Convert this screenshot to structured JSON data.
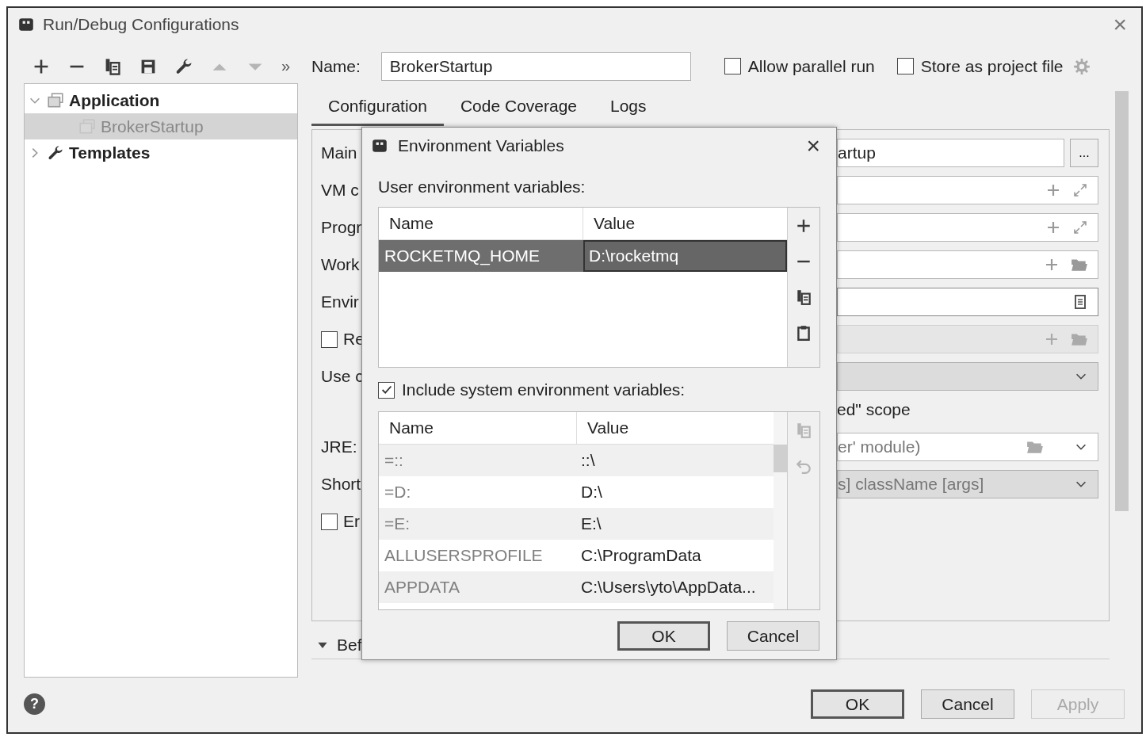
{
  "window": {
    "title": "Run/Debug Configurations",
    "close": "×"
  },
  "toolbar": [
    {
      "kind": "add",
      "disabled": false
    },
    {
      "kind": "remove",
      "disabled": false
    },
    {
      "kind": "copy",
      "disabled": false
    },
    {
      "kind": "save",
      "disabled": false
    },
    {
      "kind": "wrench",
      "disabled": false
    },
    {
      "kind": "up",
      "disabled": true
    },
    {
      "kind": "down",
      "disabled": true
    }
  ],
  "toolbar_overflow": "»",
  "name_field": {
    "label": "Name:",
    "value": "BrokerStartup"
  },
  "options": [
    {
      "label": "Allow parallel run",
      "checked": false
    },
    {
      "label": "Store as project file",
      "checked": false
    }
  ],
  "tree": [
    {
      "label": "Application",
      "kind": "application",
      "expanded": true,
      "selected": false,
      "children": [
        {
          "label": "BrokerStartup",
          "selected": true
        }
      ]
    },
    {
      "label": "Templates",
      "kind": "templates",
      "expanded": false,
      "selected": false
    }
  ],
  "tabs": [
    {
      "label": "Configuration",
      "selected": true
    },
    {
      "label": "Code Coverage",
      "selected": false
    },
    {
      "label": "Logs",
      "selected": false
    }
  ],
  "form": [
    {
      "kind": "browse",
      "label": "Main",
      "value": "artup",
      "button": "..."
    },
    {
      "kind": "expandable",
      "label": "VM c"
    },
    {
      "kind": "expandable",
      "label": "Progr"
    },
    {
      "kind": "folder",
      "label": "Work"
    },
    {
      "kind": "document",
      "label": "Envir"
    },
    {
      "kind": "disabled_folder",
      "label": "Re",
      "checked": false
    },
    {
      "kind": "disabled_combo",
      "label": "Use c"
    },
    {
      "kind": "note",
      "value": "ed\" scope"
    },
    {
      "kind": "folder_combo",
      "label": "JRE:",
      "value": "er' module)"
    },
    {
      "kind": "disabled_combo",
      "label": "Short",
      "value": "s] className [args]"
    },
    {
      "kind": "empty",
      "label": "Er",
      "checked": false
    }
  ],
  "before_launch": {
    "label": "Bef",
    "expanded": true
  },
  "help": "?",
  "buttons": [
    {
      "label": "OK",
      "default": true,
      "disabled": false
    },
    {
      "label": "Cancel",
      "default": false,
      "disabled": false
    },
    {
      "label": "Apply",
      "default": false,
      "disabled": true
    }
  ],
  "env_dialog": {
    "title": "Environment Variables",
    "close": "×",
    "user_label": "User environment variables:",
    "user_table": {
      "columns": [
        "Name",
        "Value"
      ],
      "rows": [
        {
          "name": "ROCKETMQ_HOME",
          "value": "D:\\rocketmq",
          "selected": true
        }
      ]
    },
    "include_system": {
      "label": "Include system environment variables:",
      "checked": true
    },
    "system_table": {
      "columns": [
        "Name",
        "Value"
      ],
      "rows": [
        {
          "name": "=::",
          "value": "::\\",
          "selected": false
        },
        {
          "name": "=D:",
          "value": "D:\\",
          "selected": false
        },
        {
          "name": "=E:",
          "value": "E:\\",
          "selected": false
        },
        {
          "name": "ALLUSERSPROFILE",
          "value": "C:\\ProgramData",
          "selected": false
        },
        {
          "name": "APPDATA",
          "value": "C:\\Users\\yto\\AppData...",
          "selected": false
        }
      ]
    },
    "buttons": [
      {
        "label": "OK",
        "default": true
      },
      {
        "label": "Cancel",
        "default": false
      }
    ]
  }
}
